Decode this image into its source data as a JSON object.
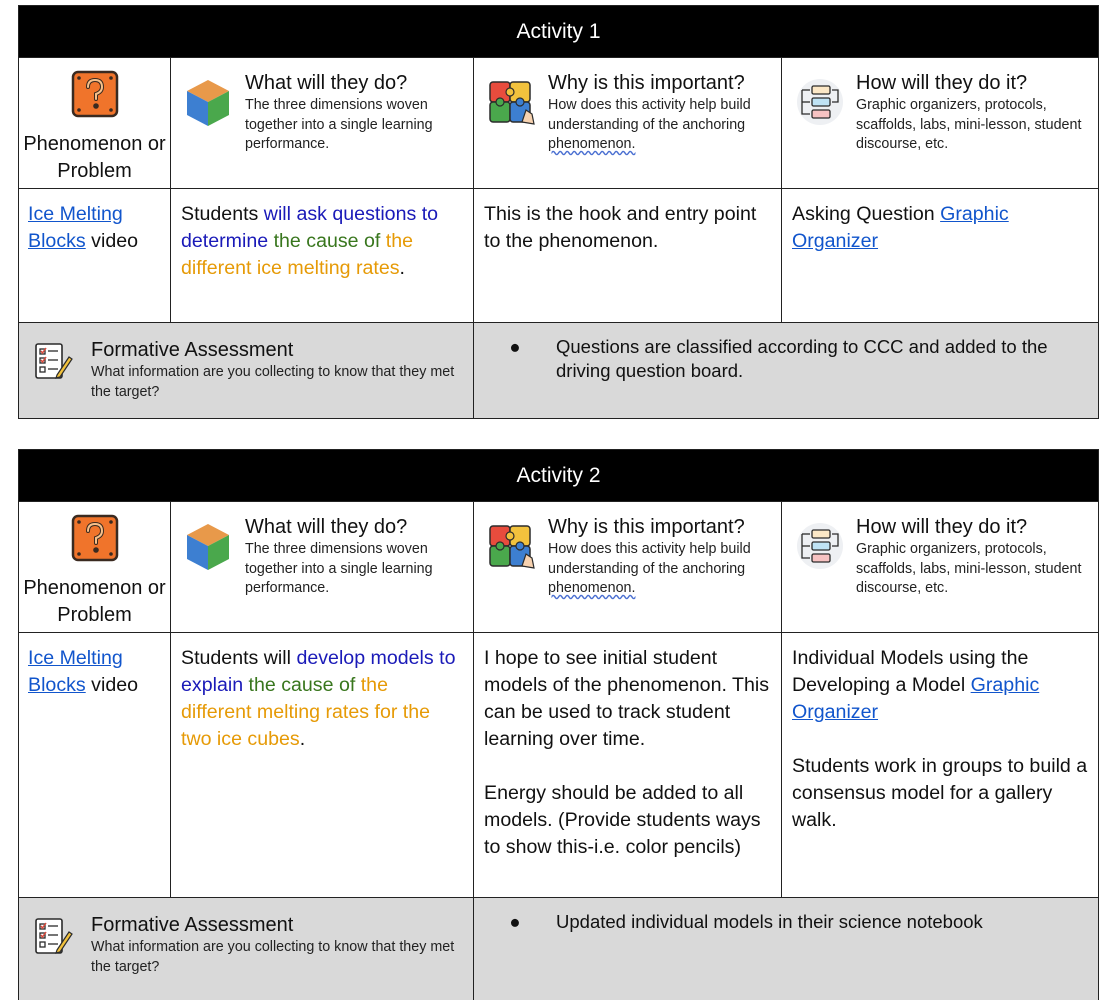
{
  "activities": [
    {
      "title": "Activity 1",
      "header": {
        "phenomenon": "Phenomenon or Problem",
        "what_title": "What will they do?",
        "what_sub": "The three dimensions woven together into a single learning performance.",
        "why_title": "Why is this important?",
        "why_sub_a": "How does this activity help build understanding of the anchoring ",
        "why_sub_b": "phenomenon.",
        "how_title": "How will they do it?",
        "how_sub": "Graphic organizers, protocols, scaffolds, labs, mini-lesson, student discourse,  etc."
      },
      "content": {
        "phen_link": "Ice Melting Blocks",
        "phen_rest": " video",
        "what_parts": [
          "Students ",
          "will ask questions to determine",
          " the cause of ",
          "the different ice melting rates",
          "."
        ],
        "why_text": "This is the hook and entry point to the phenomenon.",
        "how_text": "Asking Question ",
        "how_link": "Graphic Organizer"
      },
      "assessment": {
        "title": "Formative Assessment",
        "sub": "What information are you collecting to know  that they met the target?",
        "bullet": "●",
        "item": "Questions are classified according to CCC and added to the driving question board."
      }
    },
    {
      "title": "Activity 2",
      "header": {
        "phenomenon": "Phenomenon or Problem",
        "what_title": "What will they do?",
        "what_sub": "The three dimensions woven together into a single learning performance.",
        "why_title": "Why is this important?",
        "why_sub_a": "How does this activity help build understanding of the anchoring ",
        "why_sub_b": "phenomenon.",
        "how_title": "How will they do it?",
        "how_sub": "Graphic organizers, protocols, scaffolds, labs, mini-lesson, student discourse,  etc."
      },
      "content": {
        "phen_link": "Ice Melting Blocks",
        "phen_rest": " video",
        "what_parts": [
          "Students will ",
          "develop models to explain",
          " the cause of ",
          "the different melting rates for the two ice cubes",
          "."
        ],
        "why_p1": "I hope to see initial student models of the phenomenon. This can be used to track student learning over time.",
        "why_p2": "Energy should be added to all models. (Provide students ways to show this-i.e. color pencils)",
        "how_text": "Individual Models using the Developing a Model ",
        "how_link": "Graphic Organizer",
        "how_p2": "Students work in groups to build a consensus model for a gallery walk."
      },
      "assessment": {
        "title": "Formative Assessment",
        "sub": "What information are you collecting to know  that they met the target?",
        "bullet": "●",
        "item": "Updated individual models in their science notebook"
      }
    }
  ],
  "icons": {
    "phenomenon": "question-block-icon",
    "what": "cube-icon",
    "why": "puzzle-icon",
    "how": "flowchart-icon",
    "assessment": "checklist-icon"
  }
}
